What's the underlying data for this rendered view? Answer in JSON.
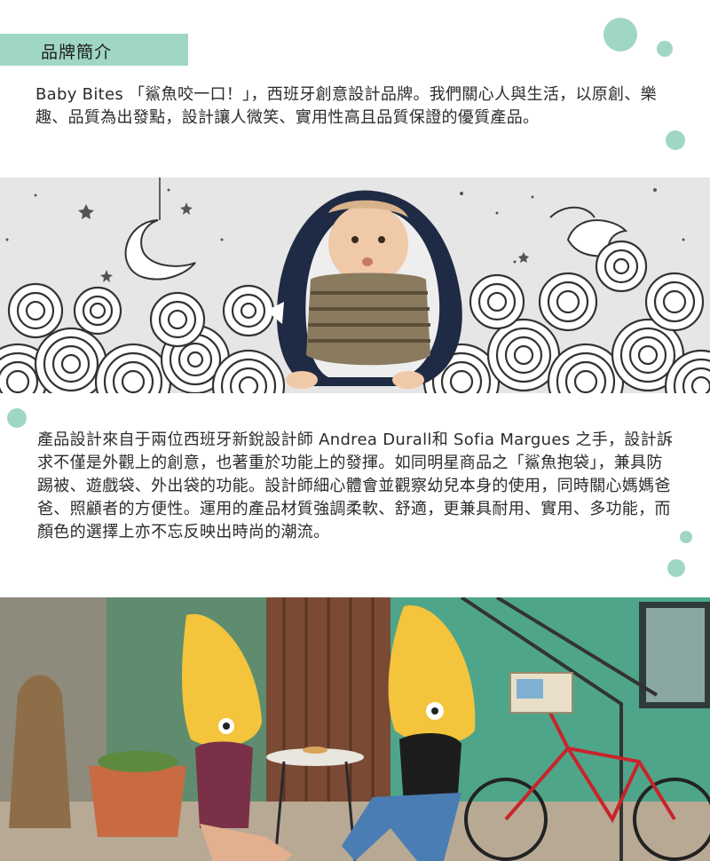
{
  "section_tag": "品牌簡介",
  "brand_paragraph": "Baby Bites 「鯊魚咬一口！」，西班牙創意設計品牌。我們關心人與生活，以原創、樂趣、品質為出發點，設計讓人微笑、實用性高且品質保證的優質產品。",
  "design_paragraph": "產品設計來自于兩位西班牙新銳設計師 Andrea Durall和 Sofia Margues 之手，設計訴求不僅是外觀上的創意，也著重於功能上的發揮。如同明星商品之「鯊魚抱袋」，兼具防踢被、遊戲袋、外出袋的功能。設計師細心體會並觀察幼兒本身的使用，同時關心媽媽爸爸、照顧者的方便性。運用的產品材質強調柔軟、舒適，更兼具耐用、實用、多功能，而顏色的選擇上亦不忘反映出時尚的潮流。",
  "colors": {
    "accent_mint": "#9fd6c6",
    "banner_gray": "#e6e6e6",
    "shark_navy": "#1f2a44",
    "costume_yellow": "#f3c43c",
    "bike_red": "#c8242b"
  },
  "images": {
    "banner": "illustration-baby-in-shark-sleeping-bag",
    "photo": "photo-two-people-wearing-shark-costumes-at-cafe"
  }
}
